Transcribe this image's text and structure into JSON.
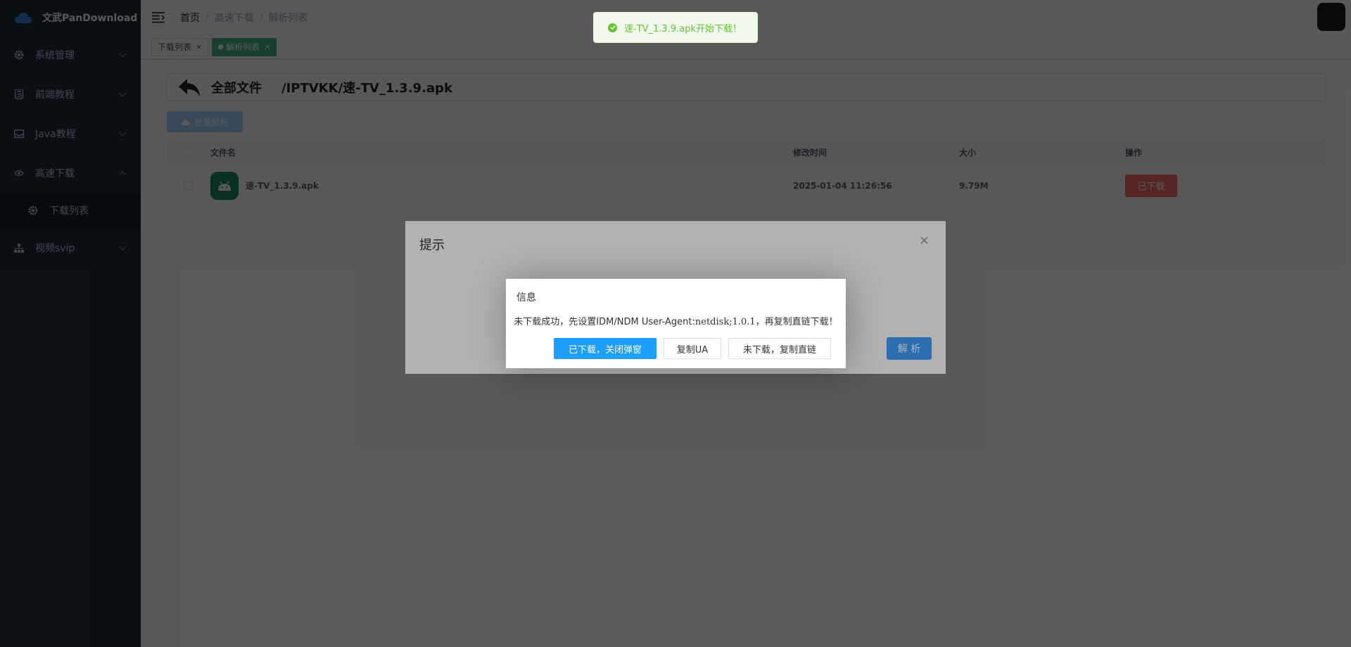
{
  "app": {
    "title": "文武PanDownload"
  },
  "sidebar": {
    "items": [
      {
        "label": "系统管理",
        "icon": "gear-icon"
      },
      {
        "label": "前端教程",
        "icon": "html5-icon"
      },
      {
        "label": "Java教程",
        "icon": "inbox-icon"
      },
      {
        "label": "高速下载",
        "icon": "eye-icon",
        "expanded": true,
        "children": [
          {
            "label": "下载列表",
            "icon": "gear-icon"
          }
        ]
      },
      {
        "label": "视频svip",
        "icon": "tree-icon"
      }
    ]
  },
  "breadcrumb": {
    "home": "首页",
    "sep": "/",
    "level1": "高速下载",
    "level2": "解析列表"
  },
  "tags": [
    {
      "label": "下载列表",
      "active": false
    },
    {
      "label": "解析列表",
      "active": true
    }
  ],
  "path": {
    "all": "全部文件",
    "current": "/IPTVKK/速-TV_1.3.9.apk"
  },
  "batch_button": "批量解析",
  "table": {
    "headers": [
      "文件名",
      "修改时间",
      "大小",
      "操作"
    ],
    "rows": [
      {
        "name": "速-TV_1.3.9.apk",
        "time": "2025-01-04 11:26:56",
        "size": "9.79M",
        "action": "已下载"
      }
    ]
  },
  "dialog": {
    "title": "提示",
    "close": "×",
    "parse_button": "解 析"
  },
  "layer": {
    "title": "信息",
    "message_prefix": "未下载成功，先设置IDM/NDM User-Agent:",
    "message_ua": "netdisk;1.0.1",
    "message_suffix": "，再复制直链下载！",
    "buttons": [
      "已下载，关闭弹窗",
      "复制UA",
      "未下载，复制直链"
    ]
  },
  "toast": {
    "message": "速-TV_1.3.9.apk开始下载！"
  },
  "colors": {
    "sidebar_bg": "#1f2d3d",
    "primary": "#409eff",
    "danger": "#f56c6c",
    "success": "#67c23a",
    "layer_primary": "#1e9fff"
  }
}
